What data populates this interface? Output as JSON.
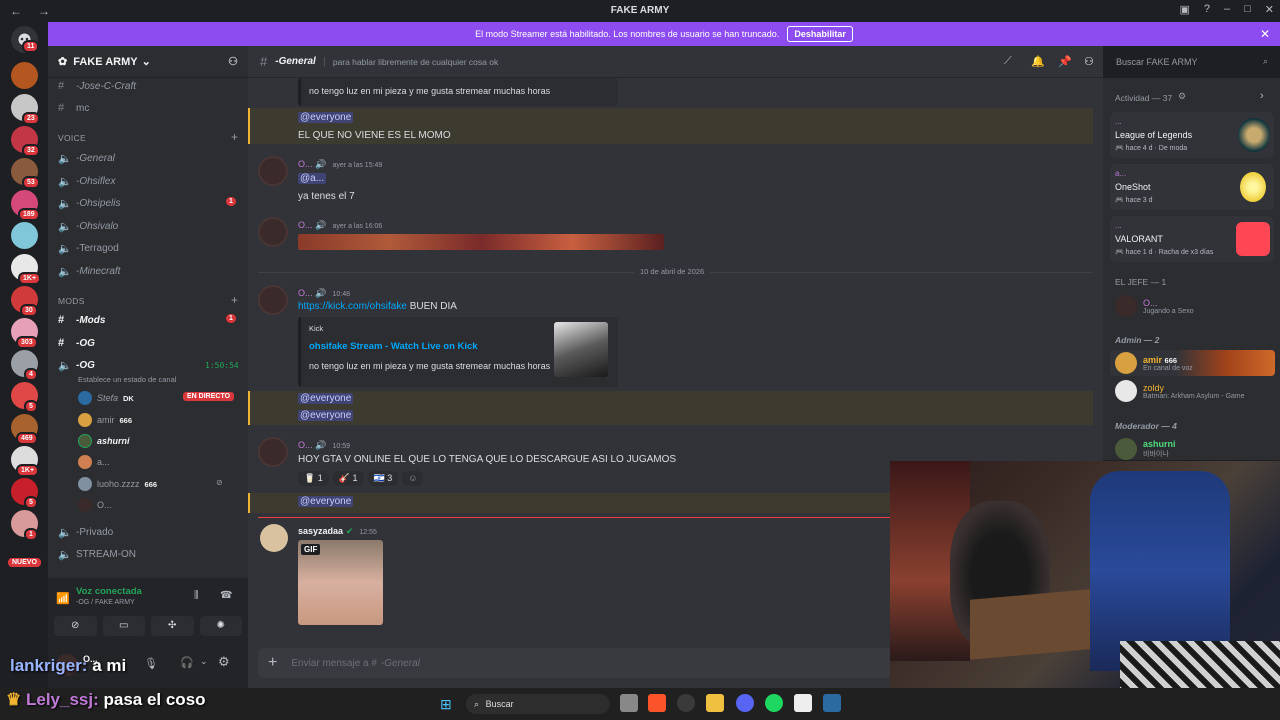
{
  "window": {
    "title": "FAKE ARMY"
  },
  "banner": {
    "text": "El modo Streamer está habilitado. Los nombres de usuario se han truncado.",
    "button": "Deshabilitar"
  },
  "servers": {
    "home_badge": "11",
    "badges": [
      "23",
      "32",
      "53",
      "189",
      "1K+",
      "30",
      "303",
      "4",
      "5",
      "469",
      "1K+",
      "5",
      "1",
      "NUEVO"
    ]
  },
  "sidebar": {
    "server_name": "FAKE ARMY",
    "channels_top": [
      "-Jose-C-Craft",
      "mc"
    ],
    "voice_category": "VOICE",
    "voice_channels": [
      {
        "name": "-General"
      },
      {
        "name": "-Ohsiflex"
      },
      {
        "name": "-Ohsipelis",
        "badge": "1"
      },
      {
        "name": "-Ohsivalo"
      },
      {
        "name": "-Terragod"
      },
      {
        "name": "-Minecraft"
      }
    ],
    "mods_category": "MODS",
    "mods_channels": [
      {
        "name": "-Mods",
        "badge": "1"
      },
      {
        "name": "-OG"
      },
      {
        "name": "-OG",
        "timer": "1:50:54",
        "status": "Establece un estado de canal"
      }
    ],
    "voice_users": [
      {
        "name": "Stefa",
        "tag": "DK",
        "live": "EN DIRECTO"
      },
      {
        "name": "amir",
        "tag": "666"
      },
      {
        "name": "ashurni"
      },
      {
        "name": "a..."
      },
      {
        "name": "luoho.zzzz",
        "tag": "666"
      },
      {
        "name": "O..."
      }
    ],
    "channels_bottom": [
      "-Privado",
      "STREAM-ON"
    ]
  },
  "voice_connected": {
    "title": "Voz conectada",
    "subtitle": "-OG / FAKE ARMY"
  },
  "userbar": {
    "name": "O..."
  },
  "chat_header": {
    "channel": "-General",
    "topic": "para hablar libremente de cualquier cosa ok",
    "search_placeholder": "Buscar FAKE ARMY"
  },
  "messages": {
    "embed_top_desc": "no tengo luz en mi pieza y me gusta stremear muchas horas",
    "everyone": "@everyone",
    "momo": "EL QUE NO VIENE ES EL MOMO",
    "m1": {
      "user": "O...",
      "time": "ayer a las 15:49",
      "mention": "@a...",
      "text": "ya tenes el 7"
    },
    "m2": {
      "user": "O...",
      "time": "ayer a las 16:06"
    },
    "divider": "10 de abril de 2026",
    "m3": {
      "user": "O...",
      "time": "10:48",
      "link": "https://kick.com/ohsifake",
      "text": "BUEN DIA",
      "embed": {
        "provider": "Kick",
        "title": "ohsifake Stream - Watch Live on Kick",
        "desc": "no tengo luz en mi pieza y me gusta stremear muchas horas"
      }
    },
    "m4": {
      "user": "O...",
      "time": "10:59",
      "text": "HOY GTA V ONLINE EL QUE LO TENGA QUE LO DESCARGUE ASI LO JUGAMOS",
      "reactions": [
        "1",
        "1",
        "3"
      ]
    },
    "m5": {
      "user": "sasyzadaa",
      "time": "12:55",
      "gif": "GIF"
    }
  },
  "input": {
    "placeholder": "Enviar mensaje a #",
    "channel": "-General"
  },
  "members": {
    "activity_header": "Actividad — 37",
    "activities": [
      {
        "user": "...",
        "game": "League of Legends",
        "detail": "hace 4 d",
        "extra": "De moda"
      },
      {
        "user": "a...",
        "game": "OneShot",
        "detail": "hace 3 d"
      },
      {
        "user": "...",
        "game": "VALORANT",
        "detail": "hace 1 d",
        "extra": "Racha de x3 días"
      }
    ],
    "groups": [
      {
        "title": "EL JEFE — 1",
        "members": [
          {
            "name": "O...",
            "status": "Jugando a Sexo",
            "color": "#c07ad6"
          }
        ]
      },
      {
        "title": "Admin — 2",
        "members": [
          {
            "name": "amir",
            "tag": "666",
            "status": "En canal de voz",
            "color": "#f0b232"
          },
          {
            "name": "zoldy",
            "status": "Batman: Arkham Asylum - Game",
            "color": "#f0b232"
          }
        ]
      },
      {
        "title": "Moderador — 4",
        "members": [
          {
            "name": "ashurni",
            "status": "비바이나",
            "color": "#4fdc7c"
          }
        ]
      }
    ]
  },
  "overlay": {
    "line1_user": "lankriger:",
    "line1_text": "a mi",
    "line2_user": "Lely_ssj:",
    "line2_text": "pasa el coso"
  },
  "taskbar": {
    "search": "Buscar"
  },
  "colors": {
    "accent": "#8c4cf0",
    "mention": "#5865f2",
    "live": "#da373c",
    "highlight": "#f0b232"
  }
}
